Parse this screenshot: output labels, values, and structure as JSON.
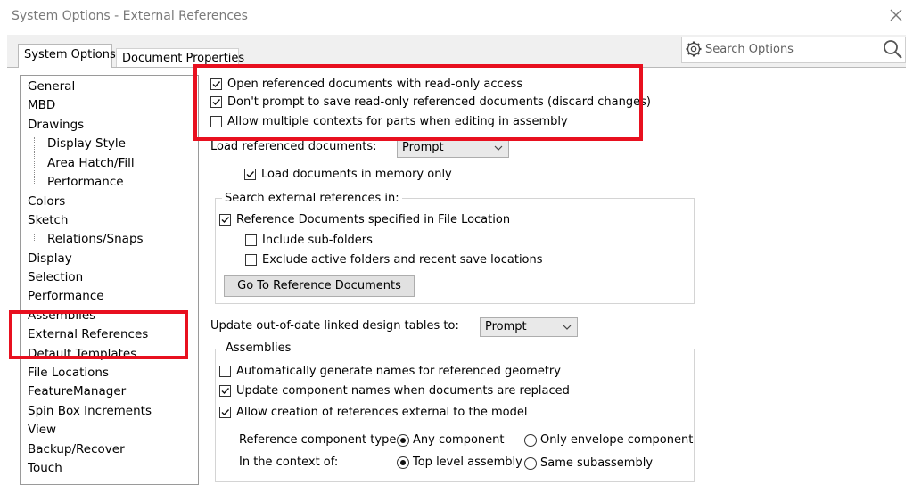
{
  "window": {
    "title": "System Options - External References"
  },
  "tabs": {
    "active": "System Options",
    "inactive": "Document Properties"
  },
  "search": {
    "placeholder": "Search Options"
  },
  "tree": [
    "General",
    "MBD",
    "Drawings",
    "Display Style",
    "Area Hatch/Fill",
    "Performance",
    "Colors",
    "Sketch",
    "Relations/Snaps",
    "Display",
    "Selection",
    "Performance",
    "Assemblies",
    "External References",
    "Default Templates",
    "File Locations",
    "FeatureManager",
    "Spin Box Increments",
    "View",
    "Backup/Recover",
    "Touch"
  ],
  "options": {
    "open_readonly": {
      "label": "Open referenced documents with read-only access",
      "checked": true
    },
    "dont_prompt_save": {
      "label": "Don't prompt to save read-only referenced documents (discard changes)",
      "checked": true
    },
    "allow_multiple_contexts": {
      "label": "Allow multiple contexts for parts when editing in assembly",
      "checked": false
    },
    "load_referenced_label": "Load referenced documents:",
    "load_referenced_value": "Prompt",
    "load_in_memory": {
      "label": "Load documents in memory only",
      "checked": true
    }
  },
  "search_group": {
    "title": "Search external references in:",
    "ref_docs_file_location": {
      "label": "Reference Documents specified in File Location",
      "checked": true
    },
    "include_subfolders": {
      "label": "Include sub-folders",
      "checked": false
    },
    "exclude_active": {
      "label": "Exclude active folders and recent save locations",
      "checked": false
    },
    "goto_button": "Go To Reference Documents"
  },
  "update_tables": {
    "label": "Update out-of-date linked design tables to:",
    "value": "Prompt"
  },
  "assemblies_group": {
    "title": "Assemblies",
    "auto_names": {
      "label": "Automatically generate names for referenced geometry",
      "checked": false
    },
    "update_names": {
      "label": "Update component names when documents are replaced",
      "checked": true
    },
    "allow_external": {
      "label": "Allow creation of references external to the model",
      "checked": true
    },
    "ref_type_label": "Reference component type:",
    "ref_type_any": "Any component",
    "ref_type_envelope": "Only envelope component",
    "context_label": "In the context of:",
    "context_top": "Top level assembly",
    "context_same": "Same subassembly"
  },
  "colors": {
    "highlight": "#e8101f"
  }
}
